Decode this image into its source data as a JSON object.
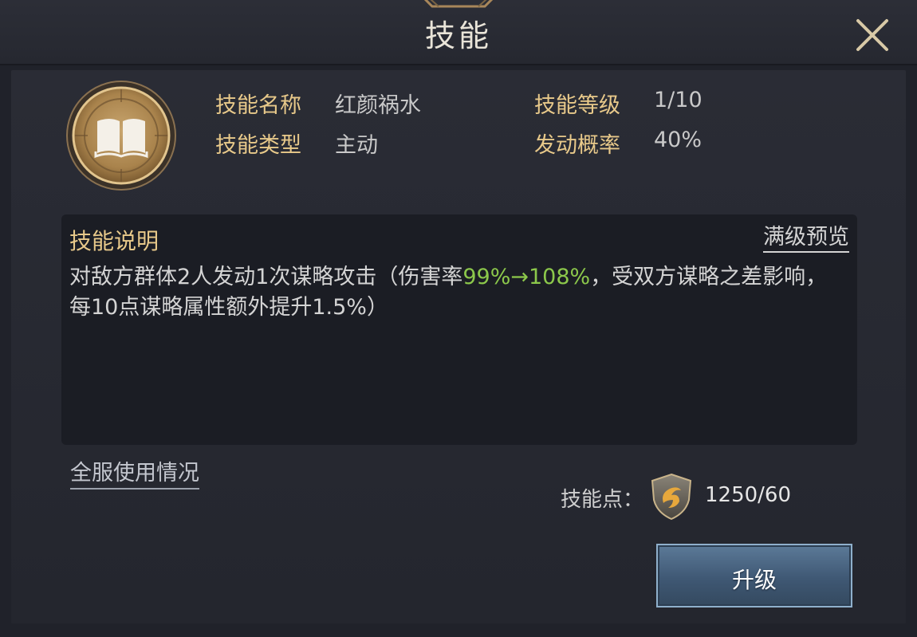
{
  "window": {
    "title": "技能"
  },
  "skill_info": {
    "name_label": "技能名称",
    "name_value": "红颜祸水",
    "type_label": "技能类型",
    "type_value": "主动",
    "level_label": "技能等级",
    "level_value": "1/10",
    "rate_label": "发动概率",
    "rate_value": "40%"
  },
  "description": {
    "title": "技能说明",
    "preview_link": "满级预览",
    "text_part1": "对敌方群体2人发动1次谋略攻击（伤害率",
    "text_highlight": "99%→108%",
    "text_part2": "，受双方谋略之差影响，每10点谋略属性额外提升1.5%）"
  },
  "footer": {
    "usage_link": "全服使用情况",
    "points_label": "技能点：",
    "points_value": "1250/60",
    "upgrade_button": "升级"
  },
  "icons": {
    "skill_icon": "book-icon",
    "points_icon": "skill-point-shield-icon",
    "close_icon": "close-icon"
  },
  "colors": {
    "label_gold": "#e8c98a",
    "highlight_green": "#8cc84b",
    "button_blue": "#3f5874"
  }
}
